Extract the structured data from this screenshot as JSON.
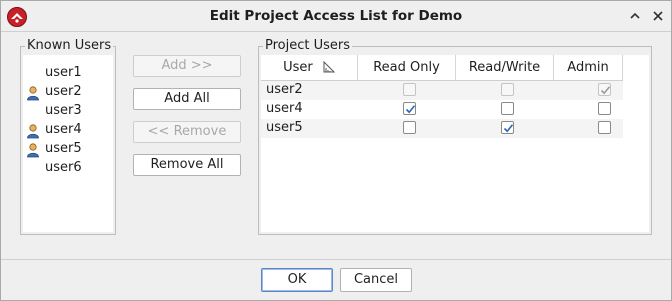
{
  "window": {
    "title": "Edit Project Access List for Demo"
  },
  "known_users": {
    "label": "Known Users",
    "items": [
      {
        "name": "user1",
        "icon": ""
      },
      {
        "name": "user2",
        "icon": "person-icon"
      },
      {
        "name": "user3",
        "icon": ""
      },
      {
        "name": "user4",
        "icon": "person-icon"
      },
      {
        "name": "user5",
        "icon": "person-icon"
      },
      {
        "name": "user6",
        "icon": ""
      }
    ]
  },
  "actions": {
    "add": "Add >>",
    "add_all": "Add All",
    "remove": "<< Remove",
    "remove_all": "Remove All"
  },
  "project_users": {
    "label": "Project Users",
    "columns": [
      "User",
      "Read Only",
      "Read/Write",
      "Admin"
    ],
    "rows": [
      {
        "user": "user2",
        "read_only": false,
        "read_write": false,
        "admin": true,
        "disabled": true
      },
      {
        "user": "user4",
        "read_only": true,
        "read_write": false,
        "admin": false,
        "disabled": false
      },
      {
        "user": "user5",
        "read_only": false,
        "read_write": true,
        "admin": false,
        "disabled": false
      }
    ]
  },
  "footer": {
    "ok": "OK",
    "cancel": "Cancel"
  },
  "colors": {
    "check_mark": "#2a63b8",
    "title_icon": "#c8202a",
    "person_icon": "#d98a2c"
  }
}
